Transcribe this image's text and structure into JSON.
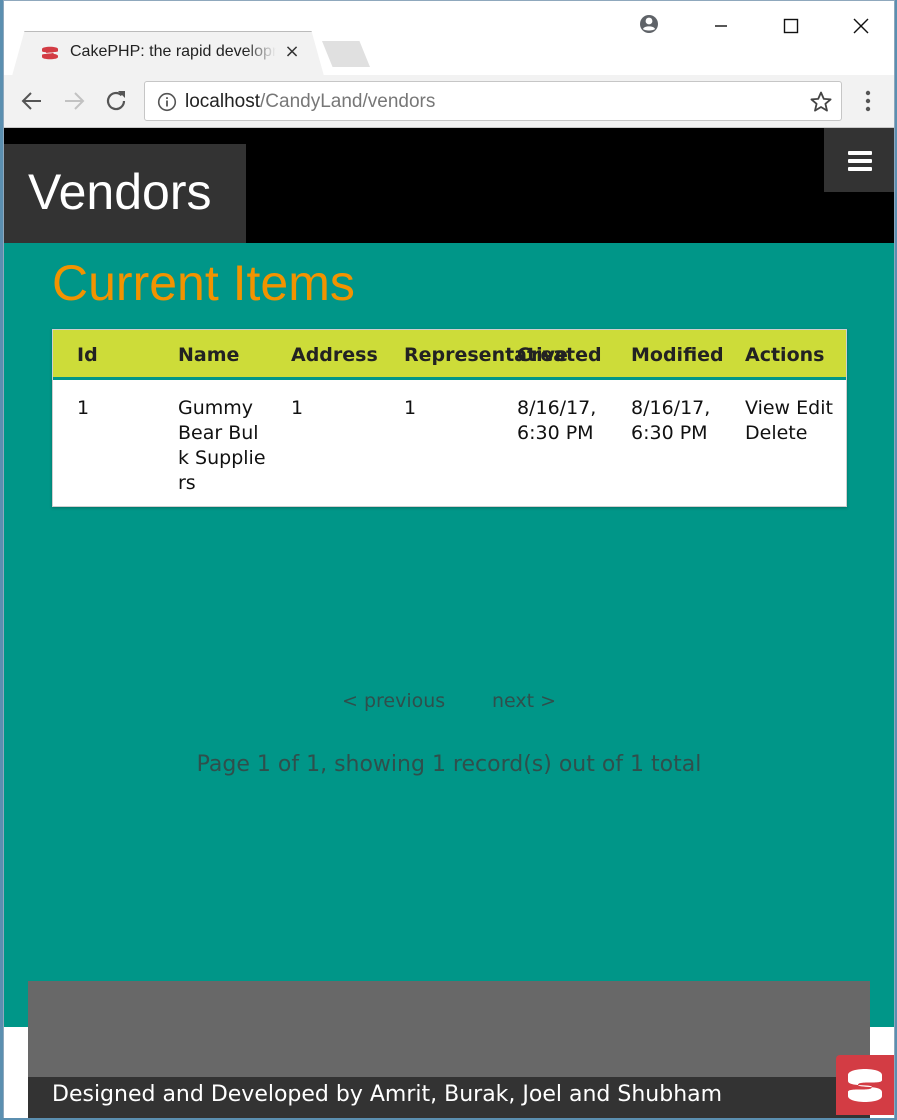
{
  "browser": {
    "tab_title": "CakePHP: the rapid development php framework",
    "tab_close": "×",
    "url_host": "localhost",
    "url_path": "/CandyLand/vendors"
  },
  "page": {
    "heading": "Vendors",
    "section_title": "Current Items",
    "table": {
      "columns": [
        "Id",
        "Name",
        "Address",
        "Representative",
        "Created",
        "Modified",
        "Actions"
      ],
      "rows": [
        {
          "id": "1",
          "name": "Gummy Bear Bulk Suppliers",
          "address": "1",
          "representative": "1",
          "created": "8/16/17, 6:30 PM",
          "modified": "8/16/17, 6:30 PM",
          "actions": [
            "View",
            "Edit",
            "Delete"
          ]
        }
      ]
    },
    "pagination": {
      "previous": "< previous",
      "next": "next >",
      "summary": "Page 1 of 1, showing 1 record(s) out of 1 total"
    },
    "footer_text": "Designed and Developed by Amrit, Burak, Joel and Shubham"
  },
  "colors": {
    "accent_teal": "#009688",
    "header_lime": "#cddc39",
    "title_orange": "#f29300",
    "cake_red": "#d33c44"
  },
  "icons": {
    "tab_favicon": "cakephp-icon",
    "profile": "account-circle-icon",
    "back": "arrow-left-icon",
    "forward": "arrow-right-icon",
    "reload": "reload-icon",
    "info": "info-icon",
    "bookmark": "star-icon",
    "menu": "menu-dots-icon",
    "hamburger": "hamburger-icon",
    "badge": "cakephp-icon"
  }
}
